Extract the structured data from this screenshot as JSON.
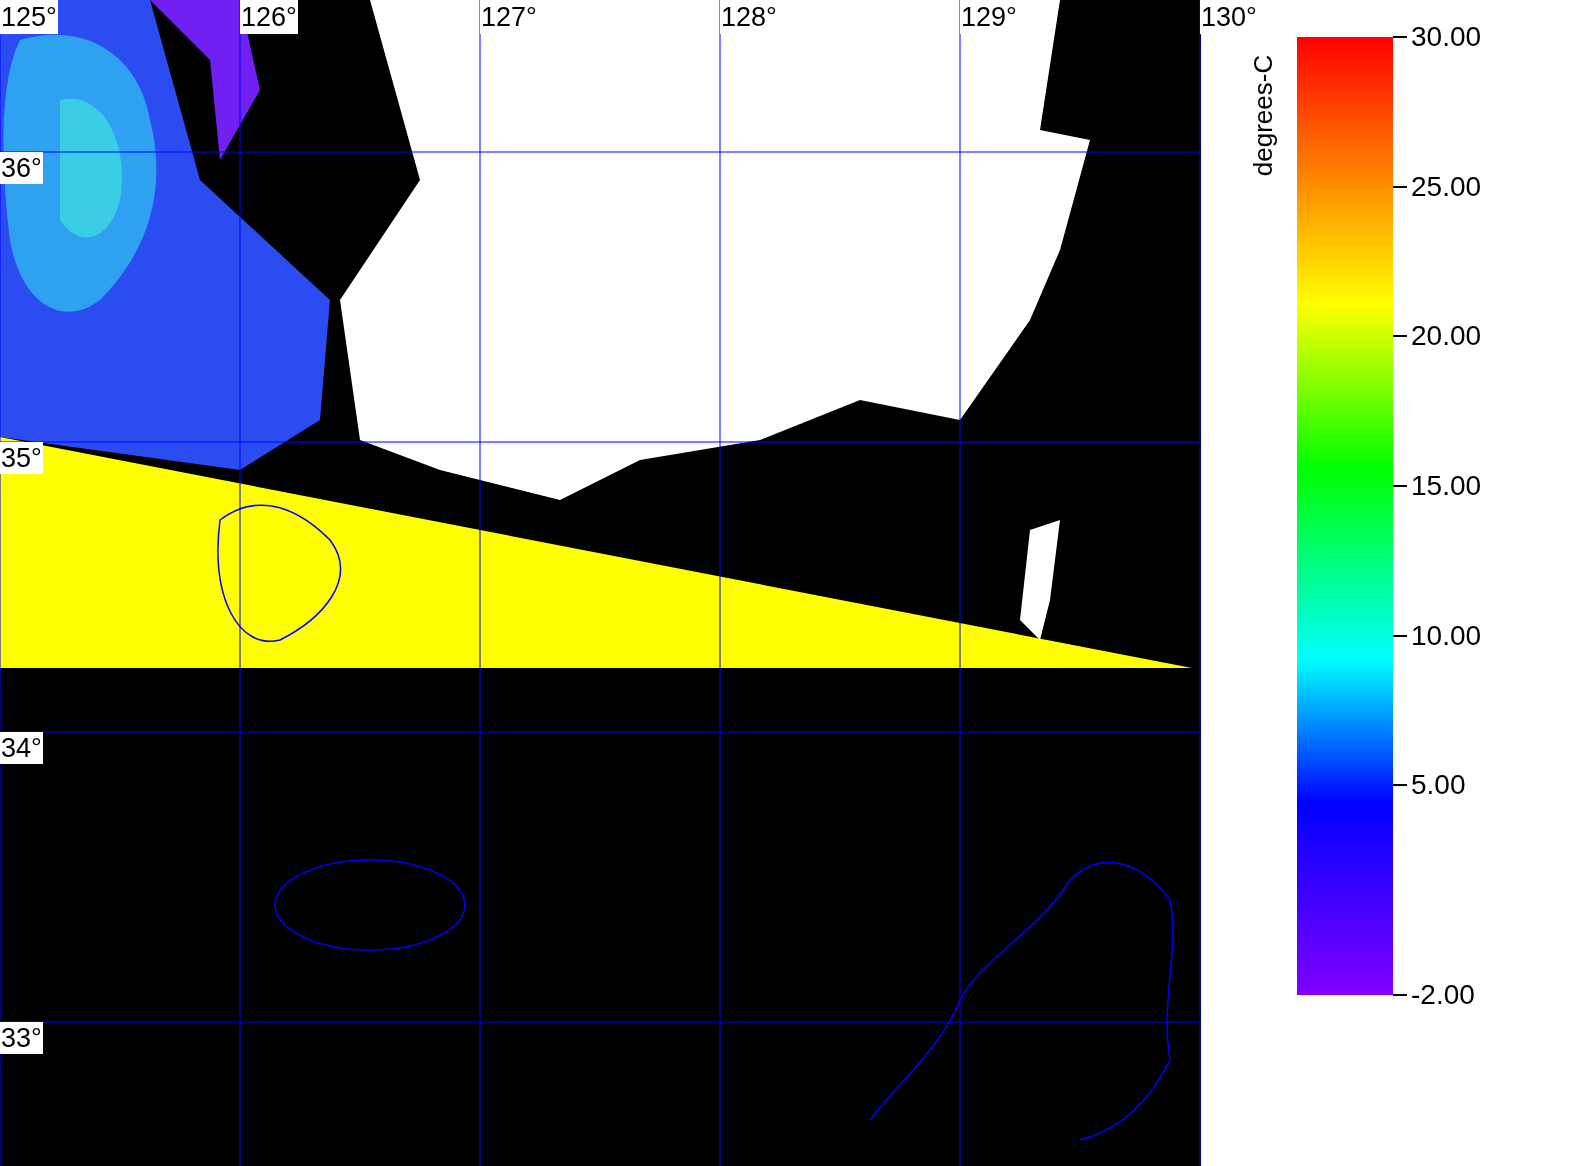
{
  "map": {
    "lon_labels": [
      "125°",
      "126°",
      "127°",
      "128°",
      "129°",
      "130°"
    ],
    "lat_labels": [
      "36°",
      "35°",
      "34°",
      "33°"
    ]
  },
  "colorbar": {
    "title": "degrees-C",
    "ticks": [
      "30.00",
      "25.00",
      "20.00",
      "15.00",
      "10.00",
      "5.00",
      "-2.00"
    ]
  }
}
